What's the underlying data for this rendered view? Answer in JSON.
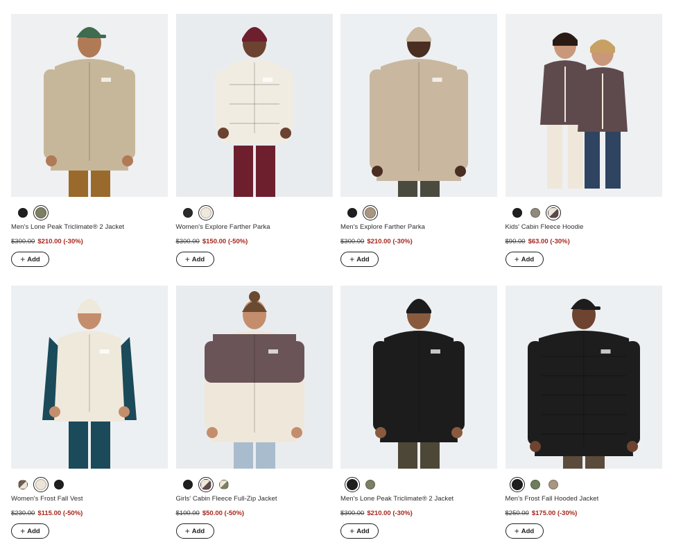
{
  "add_label": "Add",
  "products": [
    {
      "name": "Men's Lone Peak Triclimate® 2 Jacket",
      "original_price": "$300.00",
      "sale_price": "$210.00",
      "discount": "(-30%)",
      "swatches": [
        {
          "color": "#1f1f1f",
          "selected": false
        },
        {
          "color": "#7c7f63",
          "selected": true
        }
      ]
    },
    {
      "name": "Women's Explore Farther Parka",
      "original_price": "$300.00",
      "sale_price": "$150.00",
      "discount": "(-50%)",
      "swatches": [
        {
          "color": "#2a2a2a",
          "selected": false
        },
        {
          "color": "#efe9dc",
          "selected": true
        }
      ]
    },
    {
      "name": "Men's Explore Farther Parka",
      "original_price": "$300.00",
      "sale_price": "$210.00",
      "discount": "(-30%)",
      "swatches": [
        {
          "color": "#1f1f1f",
          "selected": false
        },
        {
          "color": "#a89682",
          "selected": true
        }
      ]
    },
    {
      "name": "Kids' Cabin Fleece Hoodie",
      "original_price": "$90.00",
      "sale_price": "$63.00",
      "discount": "(-30%)",
      "swatches": [
        {
          "color": "#1f1f1f",
          "selected": false
        },
        {
          "color": "#8f8a7a",
          "selected": false
        },
        {
          "color": "#5e4a4c",
          "color2": "#efe8da",
          "selected": true
        }
      ]
    },
    {
      "name": "Women's Frost Fall Vest",
      "original_price": "$230.00",
      "sale_price": "$115.00",
      "discount": "(-50%)",
      "swatches": [
        {
          "color": "#ece5d8",
          "color2": "#6e5d52",
          "selected": false
        },
        {
          "color": "#ece5d8",
          "selected": true
        },
        {
          "color": "#1f1f1f",
          "selected": false
        }
      ]
    },
    {
      "name": "Girls' Cabin Fleece Full-Zip Jacket",
      "original_price": "$100.00",
      "sale_price": "$50.00",
      "discount": "(-50%)",
      "swatches": [
        {
          "color": "#1f1f1f",
          "selected": false
        },
        {
          "color": "#5e4a4c",
          "color2": "#efe8da",
          "selected": true
        },
        {
          "color": "#7c7f63",
          "color2": "#efe8da",
          "selected": false
        }
      ]
    },
    {
      "name": "Men's Lone Peak Triclimate® 2 Jacket",
      "original_price": "$300.00",
      "sale_price": "$210.00",
      "discount": "(-30%)",
      "swatches": [
        {
          "color": "#1f1f1f",
          "selected": true
        },
        {
          "color": "#7c7f63",
          "selected": false
        }
      ]
    },
    {
      "name": "Men's Frost Fall Hooded Jacket",
      "original_price": "$250.00",
      "sale_price": "$175.00",
      "discount": "(-30%)",
      "swatches": [
        {
          "color": "#1f1f1f",
          "selected": true
        },
        {
          "color": "#6e7d5e",
          "selected": false
        },
        {
          "color": "#a89682",
          "selected": false
        }
      ]
    }
  ]
}
